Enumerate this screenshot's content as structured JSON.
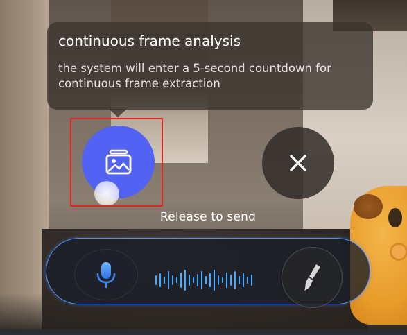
{
  "tooltip": {
    "title": "continuous frame analysis",
    "description": "the system will enter a 5-second countdown for continuous frame extraction"
  },
  "record_button": {
    "icon": "image-frames-icon",
    "color": "#5263f3"
  },
  "close_button": {
    "icon": "close-icon"
  },
  "hint": {
    "label": "Release to send"
  },
  "voice_bar": {
    "mic_icon": "microphone-icon",
    "waveform_icon": "waveform-icon",
    "brush_icon": "brush-icon",
    "accent": "#4f8fff"
  },
  "highlight": {
    "color": "#e2261f"
  }
}
